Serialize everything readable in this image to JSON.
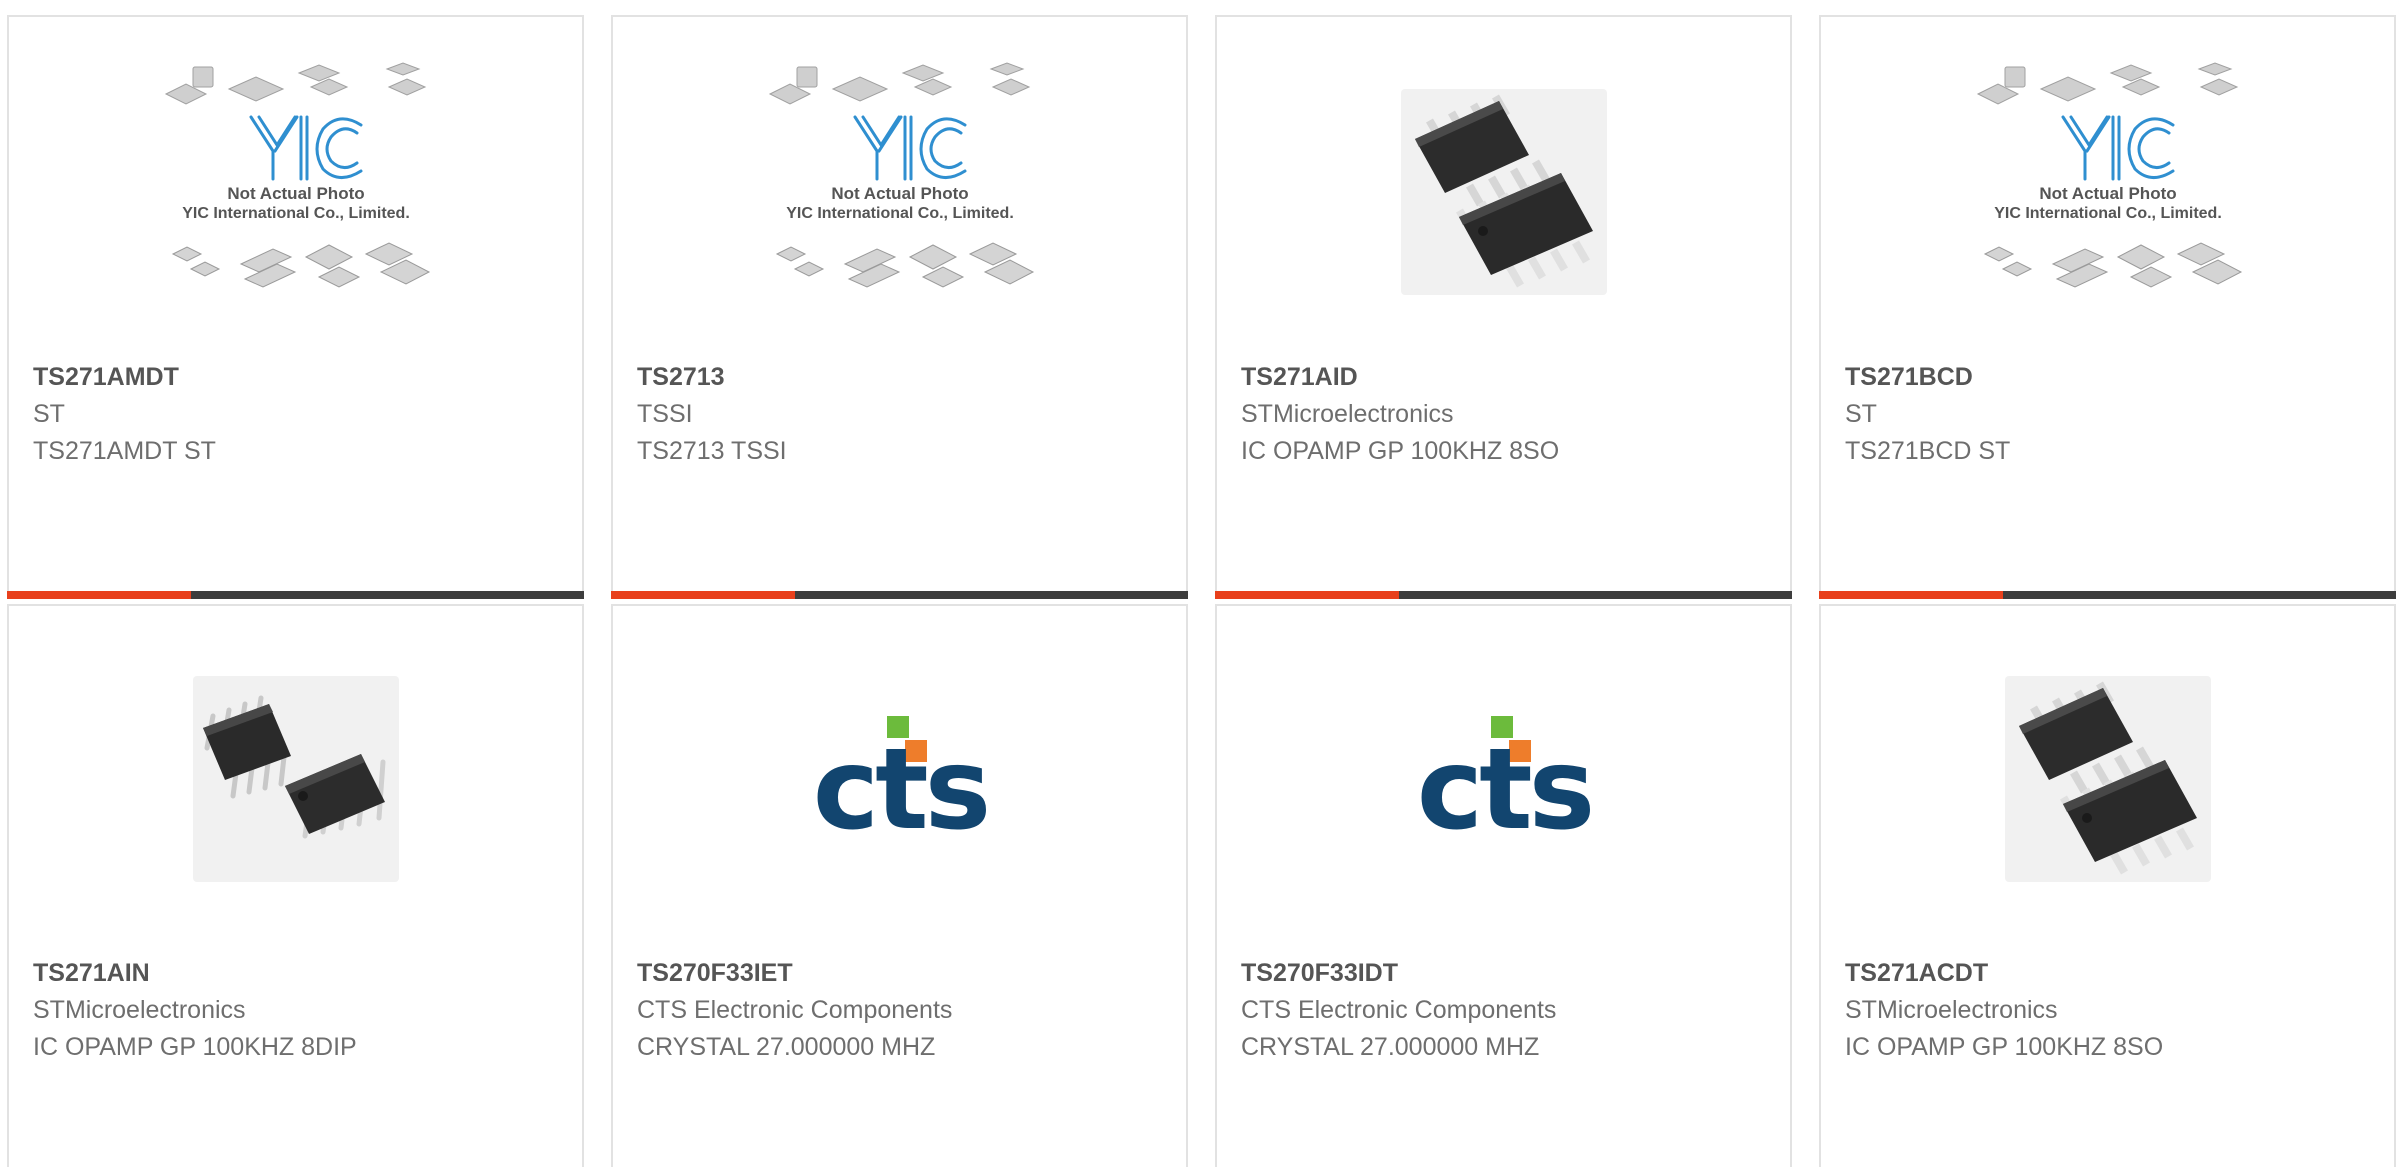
{
  "colors": {
    "accent": "#e8401c",
    "bar_dark": "#3d3d3d",
    "border": "#e2e2e2",
    "part_text": "#555555",
    "secondary_text": "#6e6e6e",
    "cts_blue": "#12456f",
    "cts_green": "#6cbb3c",
    "cts_orange": "#ee7d2b",
    "yic_blue": "#2f8fd0"
  },
  "placeholder_logo": {
    "brand": "YIC",
    "line1": "Not Actual Photo",
    "line2": "YIC International Co., Limited."
  },
  "cts_logo": {
    "text": "cts"
  },
  "cards": [
    {
      "part": "TS271AMDT",
      "manufacturer": "ST",
      "description": "TS271AMDT ST",
      "image": "yic-placeholder"
    },
    {
      "part": "TS2713",
      "manufacturer": "TSSI",
      "description": "TS2713 TSSI",
      "image": "yic-placeholder"
    },
    {
      "part": "TS271AID",
      "manufacturer": "STMicroelectronics",
      "description": "IC OPAMP GP 100KHZ 8SO",
      "image": "soic-8-chip"
    },
    {
      "part": "TS271BCD",
      "manufacturer": "ST",
      "description": "TS271BCD ST",
      "image": "yic-placeholder"
    },
    {
      "part": "TS271AIN",
      "manufacturer": "STMicroelectronics",
      "description": "IC OPAMP GP 100KHZ 8DIP",
      "image": "dip-8-chip"
    },
    {
      "part": "TS270F33IET",
      "manufacturer": "CTS Electronic Components",
      "description": "CRYSTAL 27.000000 MHZ",
      "image": "cts-logo"
    },
    {
      "part": "TS270F33IDT",
      "manufacturer": "CTS Electronic Components",
      "description": "CRYSTAL 27.000000 MHZ",
      "image": "cts-logo"
    },
    {
      "part": "TS271ACDT",
      "manufacturer": "STMicroelectronics",
      "description": "IC OPAMP GP 100KHZ 8SO",
      "image": "soic-8-chip"
    }
  ]
}
